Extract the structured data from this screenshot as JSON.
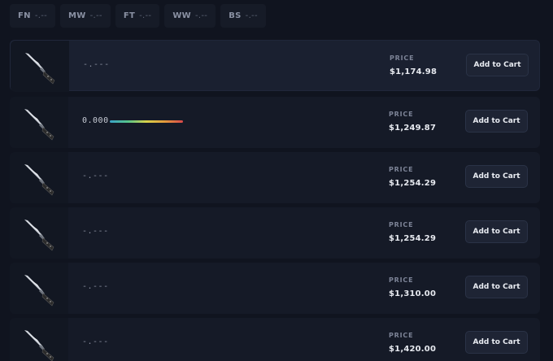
{
  "wear_filters": [
    {
      "code": "FN",
      "value": "-.--"
    },
    {
      "code": "MW",
      "value": "-.--"
    },
    {
      "code": "FT",
      "value": "-.--"
    },
    {
      "code": "WW",
      "value": "-.--"
    },
    {
      "code": "BS",
      "value": "-.--"
    }
  ],
  "price_label": "PRICE",
  "cart_label": "Add to Cart",
  "listings": [
    {
      "float": "-.---",
      "has_float_bar": false,
      "price": "$1,174.98"
    },
    {
      "float": "0.000",
      "has_float_bar": true,
      "price": "$1,249.87"
    },
    {
      "float": "-.---",
      "has_float_bar": false,
      "price": "$1,254.29"
    },
    {
      "float": "-.---",
      "has_float_bar": false,
      "price": "$1,254.29"
    },
    {
      "float": "-.---",
      "has_float_bar": false,
      "price": "$1,310.00"
    },
    {
      "float": "-.---",
      "has_float_bar": false,
      "price": "$1,420.00"
    }
  ],
  "colors": {
    "background": "#10141f",
    "card": "#151a27",
    "button": "#1e2434",
    "float_gradient": [
      "#3aa3c7",
      "#56c48a",
      "#d7d24a",
      "#e39a3c",
      "#d8484a"
    ]
  },
  "icons": {
    "item_thumbnail": "bowie-knife-icon"
  }
}
